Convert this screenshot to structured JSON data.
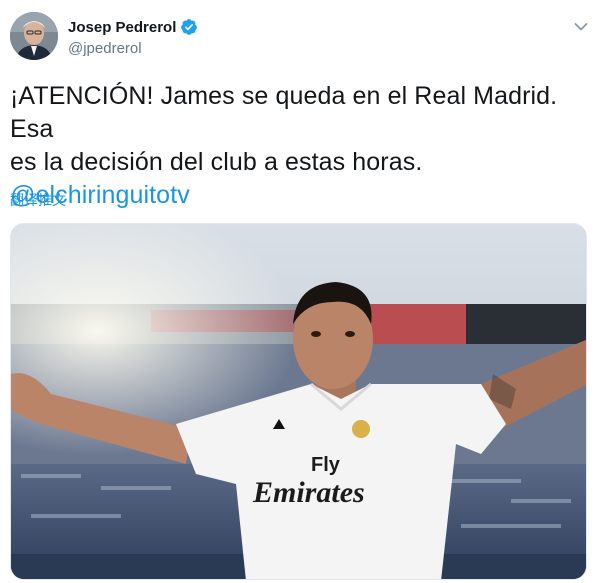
{
  "user": {
    "display_name": "Josep Pedrerol",
    "handle": "@jpedrerol",
    "verified": true,
    "avatar_icon": "profile-photo"
  },
  "tweet": {
    "text_line1": "¡ATENCIÓN! James se queda en el Real Madrid. Esa",
    "text_line2": "es la decisión del club a estas horas.",
    "mention": "@elchiringuitotv"
  },
  "actions": {
    "translate_label": "翻译推文",
    "menu_icon": "chevron-down-icon"
  },
  "media": {
    "shirt_sponsor_line1": "Fly",
    "shirt_sponsor_line2": "Emirates"
  },
  "colors": {
    "link": "#1b95e0",
    "secondary_text": "#657786",
    "verified_badge": "#1da1f2"
  }
}
